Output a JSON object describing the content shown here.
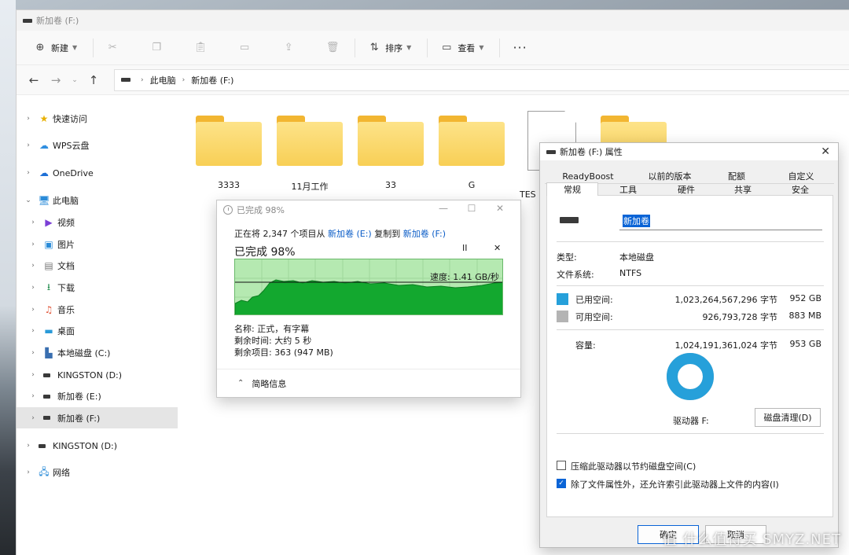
{
  "explorer": {
    "title": "新加卷 (F:)",
    "toolbar": {
      "new_label": "新建",
      "sort_label": "排序",
      "view_label": "查看",
      "more_label": "···"
    },
    "breadcrumb": [
      "此电脑",
      "新加卷 (F:)"
    ],
    "sidebar": [
      {
        "label": "快速访问",
        "icon": "star-icon"
      },
      {
        "label": "WPS云盘",
        "icon": "cloud-icon"
      },
      {
        "label": "OneDrive",
        "icon": "onedrive-icon"
      },
      {
        "label": "此电脑",
        "icon": "computer-icon"
      },
      {
        "label": "视频",
        "icon": "video-icon"
      },
      {
        "label": "图片",
        "icon": "picture-icon"
      },
      {
        "label": "文档",
        "icon": "document-icon"
      },
      {
        "label": "下载",
        "icon": "download-icon"
      },
      {
        "label": "音乐",
        "icon": "music-icon"
      },
      {
        "label": "桌面",
        "icon": "desktop-icon"
      },
      {
        "label": "本地磁盘 (C:)",
        "icon": "system-drive-icon"
      },
      {
        "label": "KINGSTON (D:)",
        "icon": "drive-icon"
      },
      {
        "label": "新加卷 (E:)",
        "icon": "drive-icon"
      },
      {
        "label": "新加卷 (F:)",
        "icon": "drive-icon"
      },
      {
        "label": "KINGSTON (D:)",
        "icon": "drive-icon"
      },
      {
        "label": "网络",
        "icon": "network-icon"
      }
    ],
    "items": [
      {
        "name": "3333",
        "type": "folder"
      },
      {
        "name": "11月工作",
        "type": "folder"
      },
      {
        "name": "33",
        "type": "folder"
      },
      {
        "name": "G",
        "type": "folder"
      },
      {
        "name": "TES",
        "type": "file"
      },
      {
        "name": "",
        "type": "folder"
      }
    ]
  },
  "copy": {
    "title": "已完成 98%",
    "status_prefix": "正在将 2,347 个项目从 ",
    "source": "新加卷 (E:)",
    "status_mid": " 复制到 ",
    "dest": "新加卷 (F:)",
    "percent_label": "已完成 98%",
    "progress": 0.98,
    "pause_symbol": "II",
    "cancel_symbol": "✕",
    "speed_label": "速度: 1.41 GB/秒",
    "name_line": "名称: 正式，有字幕",
    "time_line": "剩余时间: 大约 5 秒",
    "items_line": "剩余项目: 363 (947 MB)",
    "toggle_label": "简略信息",
    "graph_colors": {
      "fill": "#13a82f",
      "background": "#b5e9b1"
    }
  },
  "props": {
    "title": "新加卷 (F:) 属性",
    "tabs_row1": [
      "ReadyBoost",
      "以前的版本",
      "配额",
      "自定义"
    ],
    "tabs_row2": [
      "常规",
      "工具",
      "硬件",
      "共享",
      "安全"
    ],
    "volume_name": "新加卷",
    "type_label": "类型:",
    "type_value": "本地磁盘",
    "fs_label": "文件系统:",
    "fs_value": "NTFS",
    "used_label": "已用空间:",
    "used_bytes": "1,023,264,567,296 字节",
    "used_size": "952 GB",
    "free_label": "可用空间:",
    "free_bytes": "926,793,728 字节",
    "free_size": "883 MB",
    "capacity_label": "容量:",
    "capacity_bytes": "1,024,191,361,024 字节",
    "capacity_size": "953 GB",
    "used_fraction": 0.9991,
    "used_color": "#26a0da",
    "free_color": "#b4b4b4",
    "drive_label": "驱动器 F:",
    "cleanup_label": "磁盘清理(D)",
    "compress_label": "压缩此驱动器以节约磁盘空间(C)",
    "index_label": "除了文件属性外，还允许索引此驱动器上文件的内容(I)",
    "ok_label": "确定",
    "cancel_label": "取消"
  },
  "watermark": "值 什么值得买 SMYZ.NET"
}
